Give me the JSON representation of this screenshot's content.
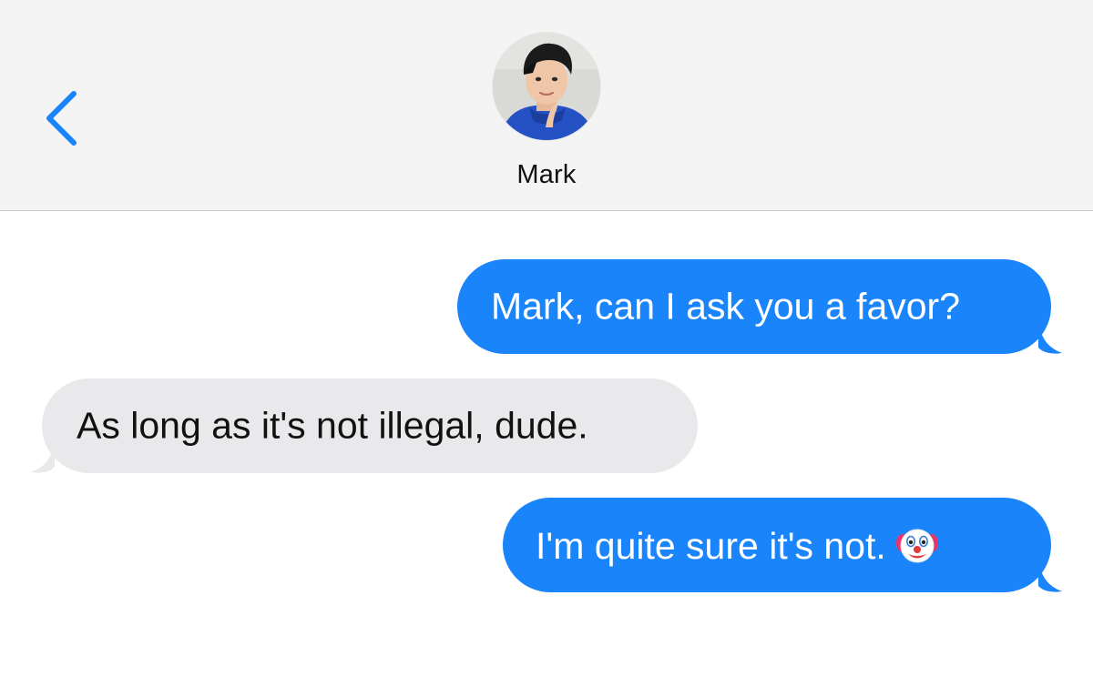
{
  "header": {
    "back_icon": "chevron-left-icon",
    "contact": {
      "name": "Mark",
      "avatar_icon": "contact-avatar-photo"
    }
  },
  "colors": {
    "accent": "#1a84fb",
    "sent_bubble": "#1a84fb",
    "received_bubble": "#e9e9eb",
    "header_bg": "#f4f4f4"
  },
  "messages": [
    {
      "direction": "sent",
      "text": "Mark, can I ask you a favor?"
    },
    {
      "direction": "received",
      "text": "As long as it's not illegal, dude."
    },
    {
      "direction": "sent",
      "text": "I'm quite sure it's not.",
      "emoji": "clown-face-emoji"
    }
  ]
}
